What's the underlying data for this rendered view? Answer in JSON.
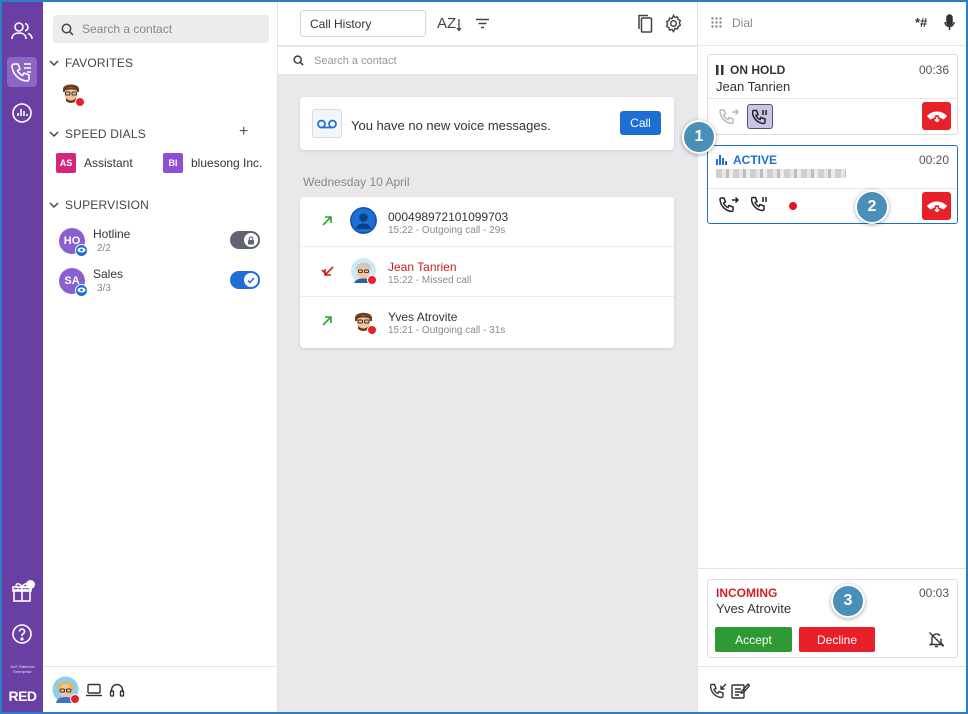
{
  "colors": {
    "rail": "#6a3fa4",
    "accent": "#1e6fd4",
    "hangup": "#e8202a",
    "accept": "#2e9a33",
    "decline": "#e8202a",
    "incoming": "#d0202a",
    "active": "#1e6fd4",
    "missed": "#c82020",
    "outgoing": "#2ba52e",
    "tag": "#4a8fb8"
  },
  "rail": {
    "items": [
      {
        "name": "contacts",
        "icon": "contacts-icon"
      },
      {
        "name": "call-history",
        "icon": "call-history-icon",
        "active": true
      },
      {
        "name": "activity",
        "icon": "activity-icon"
      }
    ],
    "bottom": [
      {
        "name": "gift",
        "icon": "gift-icon"
      },
      {
        "name": "help",
        "icon": "help-icon"
      }
    ],
    "brand_small": "ALE Rainbow Enterprise",
    "brand": "RED"
  },
  "contacts": {
    "search_placeholder": "Search a contact",
    "favorites": {
      "title": "FAVORITES"
    },
    "speed_dials": {
      "title": "SPEED DIALS",
      "add_label": "+",
      "items": [
        {
          "initials": "AS",
          "name": "Assistant",
          "color": "#d4267a"
        },
        {
          "initials": "BI",
          "name": "bluesong Inc.",
          "color": "#8d4fd4"
        }
      ]
    },
    "supervision": {
      "title": "SUPERVISION",
      "items": [
        {
          "initials": "HO",
          "name": "Hotline",
          "count": "2/2",
          "toggle": "locked"
        },
        {
          "initials": "SA",
          "name": "Sales",
          "count": "3/3",
          "toggle": "on"
        }
      ]
    }
  },
  "history": {
    "selector": "Call History",
    "sort_label": "AZ",
    "search_placeholder": "Search a contact",
    "voicemail_text": "You have no new voice messages.",
    "voicemail_button": "Call",
    "date_heading": "Wednesday 10 April",
    "calls": [
      {
        "direction": "outgoing",
        "name": "000498972101099703",
        "meta": "15:22 - Outgoing call - 29s",
        "avatar": "generic"
      },
      {
        "direction": "missed",
        "name": "Jean Tanrien",
        "meta": "15:22 - Missed call",
        "avatar": "jean"
      },
      {
        "direction": "outgoing",
        "name": "Yves Atrovite",
        "meta": "15:21 - Outgoing call - 31s",
        "avatar": "yves"
      }
    ]
  },
  "calls": {
    "dial_label": "Dial",
    "keypad_label": "*#",
    "hold": {
      "status": "ON HOLD",
      "time": "00:36",
      "name": "Jean Tanrien"
    },
    "active": {
      "status": "ACTIVE",
      "time": "00:20"
    },
    "incoming": {
      "status": "INCOMING",
      "time": "00:03",
      "name": "Yves Atrovite",
      "accept_label": "Accept",
      "decline_label": "Decline"
    },
    "tags": [
      "1",
      "2",
      "3"
    ]
  }
}
